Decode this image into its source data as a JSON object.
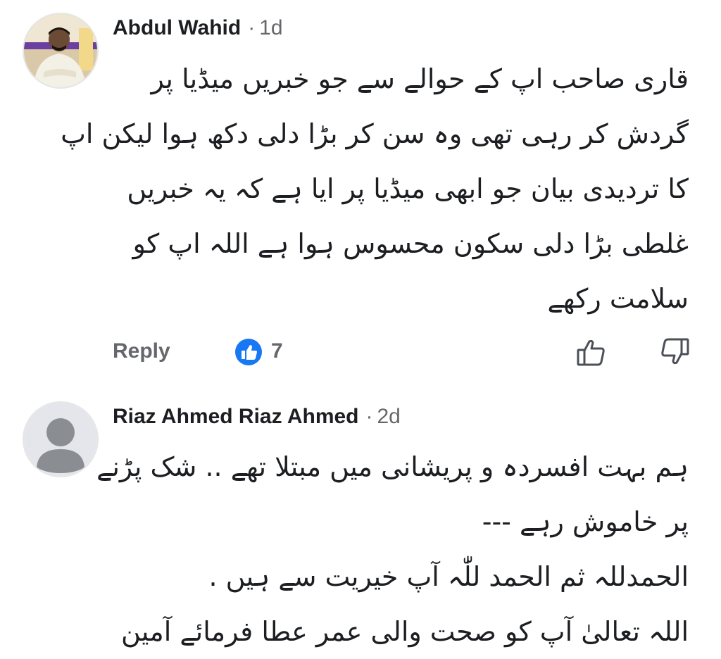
{
  "comments": [
    {
      "author": "Abdul Wahid",
      "separator": "·",
      "time": "1d",
      "lines": [
        "قاری صاحب اپ کے حوالے سے جو خبریں میڈیا پر",
        "گردش کر رہی تھی وہ سن کر بڑا دلی دکھ ہوا لیکن اپ",
        "کا تردیدی بیان جو ابھی میڈیا پر ایا ہے کہ یہ خبریں",
        "غلطی بڑا دلی سکون محسوس ہوا ہے اللہ اپ کو",
        "سلامت رکھے"
      ],
      "reply_label": "Reply",
      "reaction_count": "7",
      "avatar_icon": "user-photo",
      "reaction_icon": "like-badge-icon"
    },
    {
      "author": "Riaz Ahmed Riaz Ahmed",
      "separator": "·",
      "time": "2d",
      "lines": [
        "ہم بہت افسردہ و پریشانی میں مبتلا تھے .. شک پڑنے",
        "پر خاموش رہے ---",
        "الحمدللہ ثم الحمد للّٰہ آپ خیریت سے ہیں .",
        "اللہ تعالیٰ آپ کو صحت والی عمر عطا فرمائے آمین"
      ],
      "avatar_icon": "default-user-icon"
    }
  ],
  "colors": {
    "text": "#1c1e21",
    "muted": "#65676b",
    "like_blue": "#1877f2",
    "avatar_gray": "#e4e6eb"
  },
  "icons": {
    "like_button": "thumbs-up-outline-icon",
    "dislike_button": "thumbs-down-outline-icon"
  }
}
